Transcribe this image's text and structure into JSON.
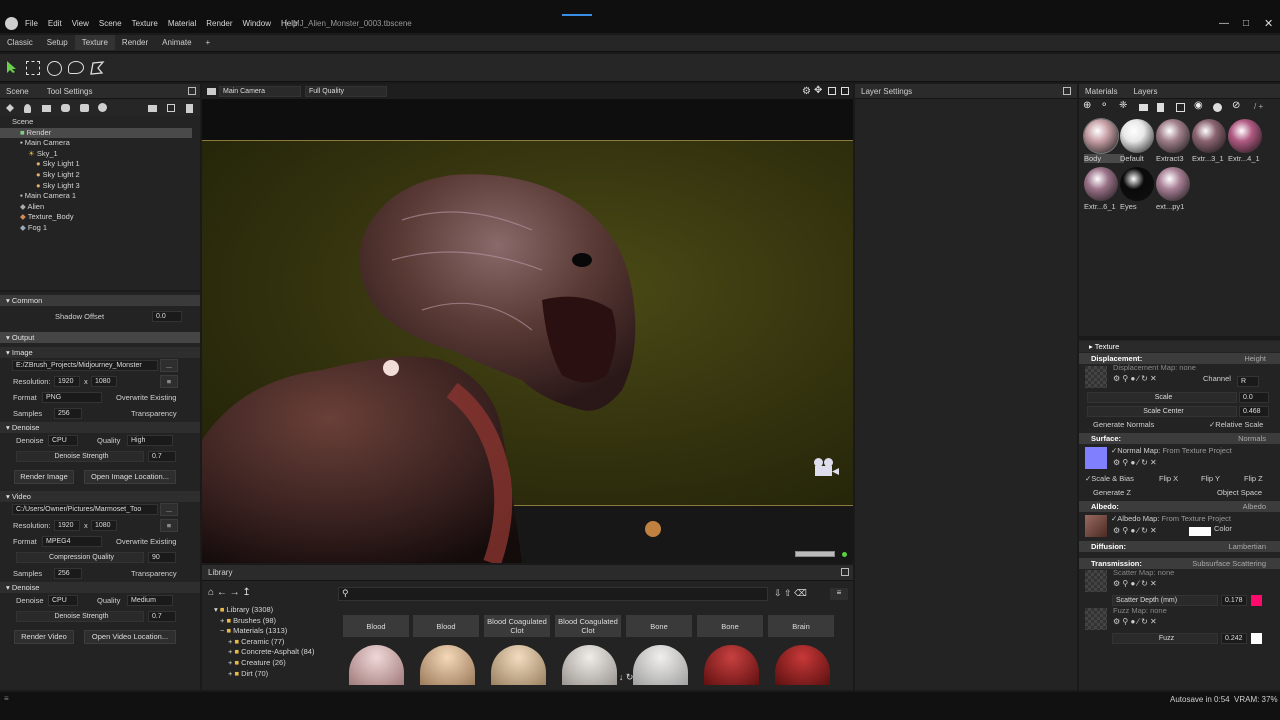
{
  "window": {
    "title": "MJ_Alien_Monster_0003.tbscene",
    "menu": [
      "File",
      "Edit",
      "View",
      "Scene",
      "Texture",
      "Material",
      "Render",
      "Window",
      "Help"
    ]
  },
  "modes": [
    "Classic",
    "Setup",
    "Texture",
    "Render",
    "Animate",
    "+"
  ],
  "scene_panel": {
    "tabs": [
      "Scene",
      "Tool Settings"
    ],
    "tree": [
      {
        "label": "Scene",
        "indent": 0
      },
      {
        "label": "Render",
        "indent": 1,
        "selected": true
      },
      {
        "label": "Main Camera",
        "indent": 1
      },
      {
        "label": "Sky_1",
        "indent": 2
      },
      {
        "label": "Sky Light 1",
        "indent": 3
      },
      {
        "label": "Sky Light 2",
        "indent": 3
      },
      {
        "label": "Sky Light 3",
        "indent": 3
      },
      {
        "label": "Main Camera 1",
        "indent": 1
      },
      {
        "label": "Alien",
        "indent": 1
      },
      {
        "label": "Texture_Body",
        "indent": 1
      },
      {
        "label": "Fog 1",
        "indent": 1
      }
    ]
  },
  "render_settings": {
    "common": "Common",
    "shadow_offset_label": "Shadow Offset",
    "shadow_offset": "0.0",
    "output": "Output",
    "image": "Image",
    "image_path": "E:/ZBrush_Projects/Midjourney_Monster",
    "browse": "...",
    "resolution_label": "Resolution:",
    "res_w": "1920",
    "res_x": "x",
    "res_h": "1080",
    "format_label": "Format",
    "image_format": "PNG",
    "overwrite": "Overwrite Existing",
    "samples_label": "Samples",
    "samples": "256",
    "transparency": "Transparency",
    "denoise": "Denoise",
    "denoise_label": "Denoise",
    "denoise_device": "CPU",
    "quality_label": "Quality",
    "image_quality": "High",
    "denoise_strength_label": "Denoise Strength",
    "denoise_strength": "0.7",
    "render_image": "Render Image",
    "open_image_location": "Open Image Location...",
    "video": "Video",
    "video_path": "C:/Users/Owner/Pictures/Marmoset_Too",
    "video_format": "MPEG4",
    "compression_label": "Compression Quality",
    "compression": "90",
    "video_quality": "Medium",
    "render_video": "Render Video",
    "open_video_location": "Open Video Location..."
  },
  "viewport": {
    "camera": "Main Camera",
    "quality": "Full Quality"
  },
  "layer_settings": {
    "title": "Layer Settings"
  },
  "materials_panel": {
    "tabs": [
      "Materials",
      "Layers"
    ],
    "counter": "/ +",
    "materials": [
      {
        "name": "Body",
        "color": "#c7a0a6"
      },
      {
        "name": "Default",
        "color": "#e8e8e8"
      },
      {
        "name": "Extract3",
        "color": "#a07f8a"
      },
      {
        "name": "Extr...3_1",
        "color": "#8a6470"
      },
      {
        "name": "Extr...4_1",
        "color": "#b05a82"
      },
      {
        "name": "Extr...6_1",
        "color": "#9a7288"
      },
      {
        "name": "Eyes",
        "color": "#0a0a0a"
      },
      {
        "name": "ext...py1",
        "color": "#a88096"
      }
    ]
  },
  "material_props": {
    "texture": "Texture",
    "displacement": "Displacement:",
    "displacement_mode": "Height",
    "displacement_map": "Displacement Map: none",
    "channel_label": "Channel",
    "channel": "R",
    "scale_label": "Scale",
    "scale": "0.0",
    "scale_center_label": "Scale Center",
    "scale_center": "0.468",
    "generate_normals": "Generate Normals",
    "relative_scale": "Relative Scale",
    "surface": "Surface:",
    "surface_mode": "Normals",
    "normal_map": "Normal Map:",
    "normal_src": "From Texture Project",
    "scale_bias": "Scale & Bias",
    "flip_x": "Flip X",
    "flip_y": "Flip Y",
    "flip_z": "Flip Z",
    "generate_z": "Generate Z",
    "object_space": "Object Space",
    "albedo": "Albedo:",
    "albedo_mode": "Albedo",
    "albedo_map": "Albedo Map:",
    "albedo_src": "From Texture Project",
    "color_label": "Color",
    "diffusion": "Diffusion:",
    "diffusion_mode": "Lambertian",
    "transmission": "Transmission:",
    "transmission_mode": "Subsurface Scattering",
    "scatter_map": "Scatter Map: none",
    "scatter_depth_label": "Scatter Depth (mm)",
    "scatter_depth": "0.178",
    "scatter_color": "#ff0a6c",
    "fuzz_map": "Fuzz Map: none",
    "fuzz_label": "Fuzz",
    "fuzz": "0.242"
  },
  "library": {
    "title": "Library",
    "tree": [
      "Library (3308)",
      "Brushes (98)",
      "Materials (1313)",
      "Ceramic (77)",
      "Concrete-Asphalt (84)",
      "Creature (26)",
      "Dirt (70)"
    ],
    "items": [
      "Blood",
      "Blood",
      "Blood Coagulated Clot",
      "Blood Coagulated Clot",
      "Bone",
      "Bone",
      "Brain"
    ]
  },
  "status": {
    "autosave": "Autosave in 0:54",
    "vram": "VRAM: 37%"
  },
  "colors": {
    "accent": "#3a8ee6",
    "selection": "#4a4a4a",
    "normal_swatch": "#8080ff",
    "albedo_color": "#ffffff",
    "fuzz_color": "#ffffff"
  }
}
